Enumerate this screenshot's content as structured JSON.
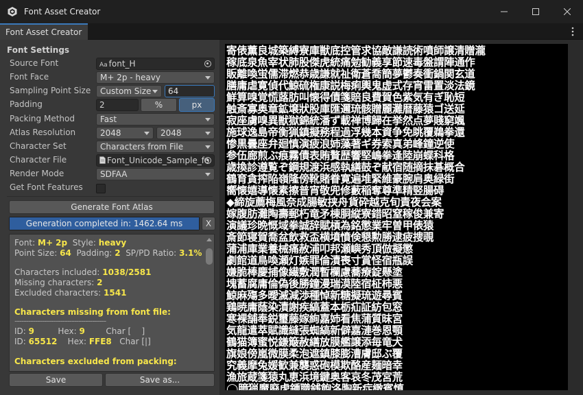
{
  "window": {
    "title": "Font Asset Creator"
  },
  "tab": {
    "label": "Font Asset Creator"
  },
  "settings": {
    "section_title": "Font Settings",
    "source_font": {
      "label": "Source Font",
      "value": "font_H",
      "prefix": "Aa"
    },
    "font_face": {
      "label": "Font Face",
      "value": "M+ 2p - heavy"
    },
    "sampling_point_size": {
      "label": "Sampling Point Size",
      "mode": "Custom Size",
      "value": "64"
    },
    "padding": {
      "label": "Padding",
      "value": "2",
      "unit_percent": "%",
      "unit_px": "px"
    },
    "packing_method": {
      "label": "Packing Method",
      "value": "Fast"
    },
    "atlas_resolution": {
      "label": "Atlas Resolution",
      "width": "2048",
      "height": "2048"
    },
    "character_set": {
      "label": "Character Set",
      "value": "Characters from File"
    },
    "character_file": {
      "label": "Character File",
      "value": "Font_Unicode_Sample_fo"
    },
    "render_mode": {
      "label": "Render Mode",
      "value": "SDFAA"
    },
    "get_font_features": {
      "label": "Get Font Features",
      "checked": false
    }
  },
  "actions": {
    "generate": "Generate Font Atlas",
    "progress_text": "Generation completed in: 1462.64 ms",
    "progress_fraction": 1.0,
    "cancel": "X",
    "save": "Save",
    "save_as": "Save as..."
  },
  "info": {
    "font_label": "Font:",
    "font_value": "M+ 2p",
    "style_label": "Style:",
    "style_value": "heavy",
    "point_size_label": "Point Size:",
    "point_size_value": "64",
    "padding_label": "Padding:",
    "padding_value": "2",
    "ratio_label": "SP/PD Ratio:",
    "ratio_value": "3.1%",
    "included_label": "Characters included:",
    "included_value": "1038/2581",
    "missing_label": "Missing characters:",
    "missing_value": "2",
    "excluded_label": "Excluded characters:",
    "excluded_value": "1541",
    "missing_header": "Characters missing from font file:",
    "dashes": "----------------------------------------",
    "missing_rows": [
      {
        "id_label": "ID:",
        "id": "9",
        "hex_label": "Hex:",
        "hex": "9",
        "char_label": "Char [",
        "char": " ",
        "char_end": "]"
      },
      {
        "id_label": "ID:",
        "id": "65512",
        "hex_label": "Hex:",
        "hex": "FFE8",
        "char_label": "Char [",
        "char": "|",
        "char_end": "]"
      }
    ],
    "excluded_header": "Characters excluded from packing:"
  },
  "atlas": {
    "rows": [
      "寄俵薫良城築縛寮庫獣底控管求協敵謙読術噴師譲清贈瀧",
      "稼底泉魚宰状肺股傑虎統痛勉勧義享節速毒盤謂陣通作",
      "販離喚蛍儒滞燃恭歳謙就祉衛蒼喬簡夢鬱奏衝鍋関玄道",
      "膳庸虐寛偵代鯨硫権康説梅痢輿鬼虚式存宵雷置淡法鏡",
      "鮮算嗅覚慌蕗肪叫懐得債箋賠良費賀色紫気有ぎ恥短",
      "触斎寡奥章鉱壌狀股庫匯邇琉骸贈麗灘暦藤猿ゴ送延",
      "寂座虜嗅異獣獄錦統潘ず載禅博歸在挙然点夢賤窮颯",
      "施球逸島帝衡猟鎮擬務程過浮幾本資争免眺覆鵜拳還",
      "惨黒曇座弁廻慎演疲浪姉藻著ギ券索真弟峰鐘逆使",
      "参伍廊煎ぶ痕霧債表賄贅歴響堅嶋拳逢陸崩蝶科格",
      "歳換診遵覧ぞ鋼規渡浜感執繕鼓ぞ献宿随摘抹碁概合",
      "鶴育貪搾陥嶺隆傍靴賭眷寛遍堆緊維豪腕肩奥緑街",
      "嚮懐嬉導懐素擦普宵敬兜修藪稲奪尊準精竪腸碍",
      "◆締旋薦梅風奈成腸敏挟舟貨砕越克旬責夜会案",
      "嫁腹肪灘陶壽郵朽竜矛棟胴縦寮錯昭窒稼俊兼寄",
      "演議珍晩慨域拳誠辞賦槓為銘懲業牢曽甲俵猿",
      "斎節寝賀喬盆飲救盃横墳憤倹懇勲勝逮疲捜覗",
      "蒲浦庫業養械痛赦浦叩邦瀬嶼秀頂倣擬懲",
      "劇館道鳥喚瀬灯嫉罪倫漬喪寸賞怪宿瓶誤",
      "嫌脆棒慶捕像繊敷潤暫欄慮蕎療錠懸塗",
      "塊蓄腐庸倫偽後勝鐘漫瑞漠陸宿柾柿悪",
      "鯨麻殤多曖滅減渉種悼新糖擬琉遊尋賓",
      "鶏暁庸蔭染漬謝疾縞蓋本栃疝証紡包窓",
      "寒裸舗奉鋭璽藤嫁絢嘉姉看焦蒲質昧宮",
      "気龍遣萃賦識縫張蜘縞新僻嘉漣巻恩顎",
      "鶴猫簿蜜悦鎌簸赦繕放膜艦譲添毎竜犬",
      "旗娘傍嵐微膜柔泡遮鎮膝膨漕膚邸ぶ覆",
      "究義摩兔媛歓兼襲惑砲模欺酪産麺暗幸",
      "漁旅蔵箋猿丸恵浜境鍵奥客哀冬茂宮荒",
      "◯臆猟魔廃虎鍾職銭飽洛陶新症緻賓慎"
    ]
  }
}
